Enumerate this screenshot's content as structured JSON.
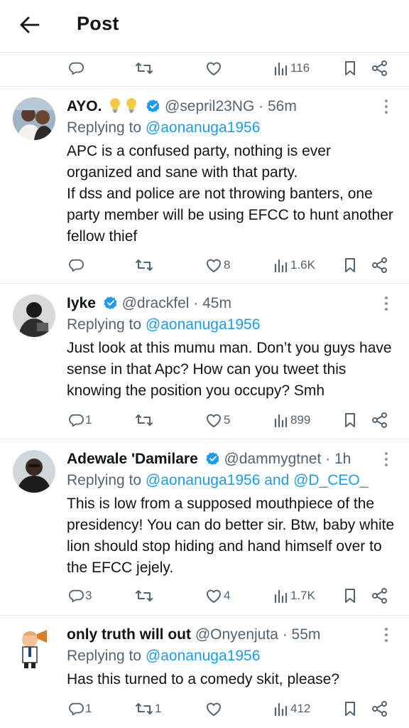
{
  "header": {
    "title": "Post"
  },
  "top_actions": {
    "views": "116"
  },
  "tweets": [
    {
      "name": "AYO.",
      "handle": "@sepril23NG",
      "time": "· 56m",
      "reply_prefix": "Replying to ",
      "reply_to": "@aonanuga1956",
      "reply_extra": "",
      "text": "APC is a confused party, nothing is ever organized and sane with that party.\nIf dss and police are not throwing banters, one party member will be using EFCC to hunt another fellow thief",
      "replies": "",
      "reposts": "",
      "likes": "8",
      "views": "1.6K"
    },
    {
      "name": "Iyke",
      "handle": "@drackfel",
      "time": "· 45m",
      "reply_prefix": "Replying to ",
      "reply_to": "@aonanuga1956",
      "reply_extra": "",
      "text": "Just look at this mumu man. Don’t you guys have sense in that Apc? How can you tweet this knowing the position you occupy? Smh",
      "replies": "1",
      "reposts": "",
      "likes": "5",
      "views": "899"
    },
    {
      "name": "Adewale 'Damilare",
      "handle": "@dammygtnet",
      "time": "· 1h",
      "reply_prefix": "Replying to ",
      "reply_to": "@aonanuga1956 and @D_CEO_",
      "reply_extra": "",
      "text": "This is low from a supposed mouthpiece of the presidency! You can do better sir. Btw, baby white lion should stop hiding and hand himself over to the EFCC jejely.",
      "replies": "3",
      "reposts": "",
      "likes": "4",
      "views": "1.7K"
    },
    {
      "name": "only truth will out",
      "handle": "@Onyenjuta",
      "time": "· 55m",
      "reply_prefix": "Replying to ",
      "reply_to": "@aonanuga1956",
      "reply_extra": "",
      "text": "Has this turned to a comedy skit, please?",
      "replies": "1",
      "reposts": "1",
      "likes": "",
      "views": "412"
    }
  ],
  "colors": {
    "accent": "#1d9bf0",
    "muted": "#536471",
    "text": "#0f1419",
    "divider": "#e6e8ea"
  }
}
